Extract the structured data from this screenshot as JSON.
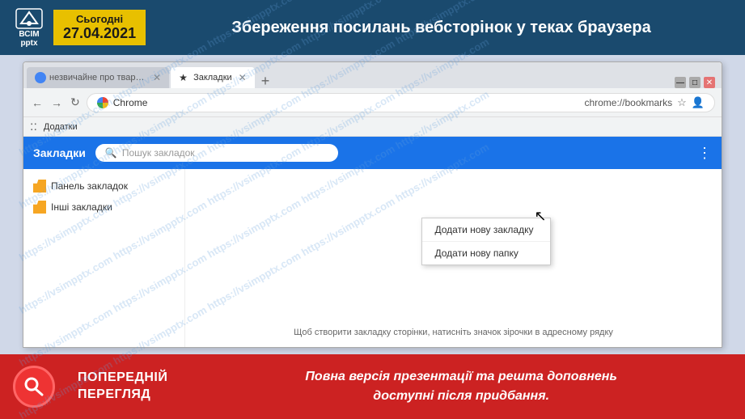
{
  "header": {
    "today_label": "Сьогодні",
    "date_value": "27.04.2021",
    "title": "Збереження посилань вебсторінок у теках браузера"
  },
  "browser": {
    "tab1_label": "незвичайне про тварин - Пош...",
    "tab2_label": "Закладки",
    "new_tab_label": "+",
    "address_brand": "Chrome",
    "address_url": "chrome://bookmarks",
    "bookmarks_btn": "Додатки",
    "bookmarks_manager_title": "Закладки",
    "search_placeholder": "Пошук закладок",
    "sidebar_item1": "Панель закладок",
    "sidebar_item2": "Інші закладки",
    "context_menu_item1": "Додати нову закладку",
    "context_menu_item2": "Додати нову папку",
    "hint_text": "Щоб створити закладку сторінки, натисніть значок зірочки в адресному рядку"
  },
  "bottom_bar": {
    "preview_label": "ПОПЕРЕДНІЙ\nПЕРЕГЛЯД",
    "bottom_text_line1": "Повна версія презентації та решта доповнень",
    "bottom_text_line2": "доступні після придбання."
  },
  "watermark": "https://vsimpptx.com"
}
